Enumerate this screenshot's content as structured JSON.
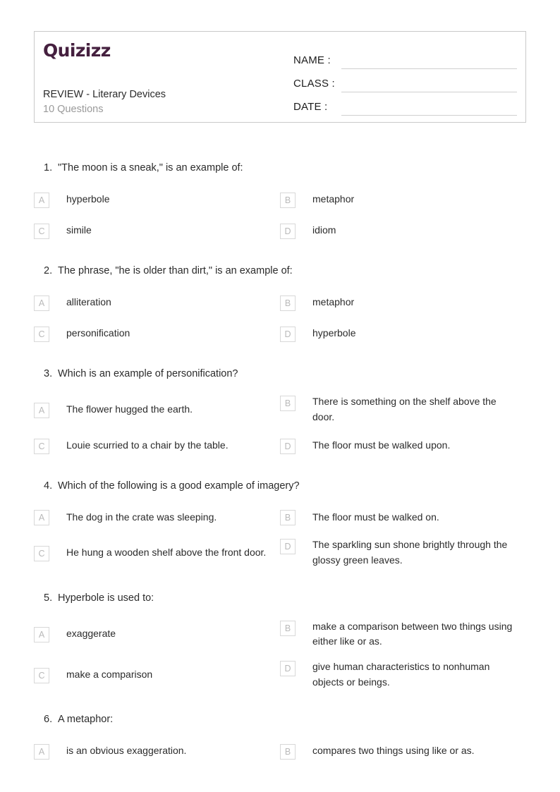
{
  "header": {
    "logo_text": "Quizizz",
    "quiz_title": "REVIEW - Literary Devices",
    "question_count_label": "10 Questions",
    "fields": [
      {
        "label": "NAME :",
        "value": ""
      },
      {
        "label": "CLASS :",
        "value": ""
      },
      {
        "label": "DATE  :",
        "value": ""
      }
    ]
  },
  "theme": {
    "logo_color": "#45203f",
    "text_color": "#2b2b2b",
    "muted_color": "#9a9a9a",
    "border_color": "#c9c9c9",
    "option_box_border": "#d8d8d8",
    "option_letter_color": "#b9b9b9"
  },
  "questions": [
    {
      "number": "1.",
      "text": "\"The moon is a sneak,\" is an example of:",
      "options": [
        {
          "letter": "A",
          "text": "hyperbole"
        },
        {
          "letter": "B",
          "text": "metaphor"
        },
        {
          "letter": "C",
          "text": "simile"
        },
        {
          "letter": "D",
          "text": "idiom"
        }
      ]
    },
    {
      "number": "2.",
      "text": "The phrase, \"he is older than dirt,\" is an example of:",
      "options": [
        {
          "letter": "A",
          "text": "alliteration"
        },
        {
          "letter": "B",
          "text": "metaphor"
        },
        {
          "letter": "C",
          "text": "personification"
        },
        {
          "letter": "D",
          "text": "hyperbole"
        }
      ]
    },
    {
      "number": "3.",
      "text": "Which is an example of personification?",
      "options": [
        {
          "letter": "A",
          "text": "The flower hugged the earth."
        },
        {
          "letter": "B",
          "text": "There is something on the shelf above the door."
        },
        {
          "letter": "C",
          "text": "Louie scurried to a chair by the table."
        },
        {
          "letter": "D",
          "text": "The floor must be walked upon."
        }
      ]
    },
    {
      "number": "4.",
      "text": "Which of the following is a good example of imagery?",
      "options": [
        {
          "letter": "A",
          "text": "The dog in the crate was sleeping."
        },
        {
          "letter": "B",
          "text": "The floor must be walked on."
        },
        {
          "letter": "C",
          "text": "He hung a wooden shelf above the front door."
        },
        {
          "letter": "D",
          "text": "The sparkling sun shone brightly through the glossy green leaves."
        }
      ]
    },
    {
      "number": "5.",
      "text": "Hyperbole is used to:",
      "options": [
        {
          "letter": "A",
          "text": "exaggerate"
        },
        {
          "letter": "B",
          "text": "make a comparison between two things using either like or as."
        },
        {
          "letter": "C",
          "text": "make a comparison"
        },
        {
          "letter": "D",
          "text": "give human characteristics to nonhuman objects or beings."
        }
      ]
    },
    {
      "number": "6.",
      "text": "A metaphor:",
      "options": [
        {
          "letter": "A",
          "text": "is an obvious exaggeration."
        },
        {
          "letter": "B",
          "text": "compares two things using like or as."
        }
      ]
    }
  ]
}
